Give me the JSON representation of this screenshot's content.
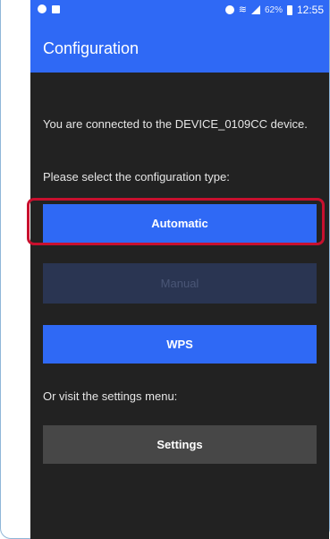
{
  "status_bar": {
    "battery": "62%",
    "time": "12:55"
  },
  "app": {
    "title": "Configuration"
  },
  "main": {
    "connected_message": "You are connected to the DEVICE_0109CC device.",
    "select_prompt": "Please select the configuration type:",
    "buttons": {
      "automatic": "Automatic",
      "manual": "Manual",
      "wps": "WPS"
    },
    "settings_prompt": "Or visit the settings menu:",
    "settings_button": "Settings"
  },
  "colors": {
    "accent": "#2f69f5",
    "background": "#222222",
    "disabled_button": "#2a3552",
    "settings_button": "#474747",
    "highlight": "#c8102e"
  }
}
